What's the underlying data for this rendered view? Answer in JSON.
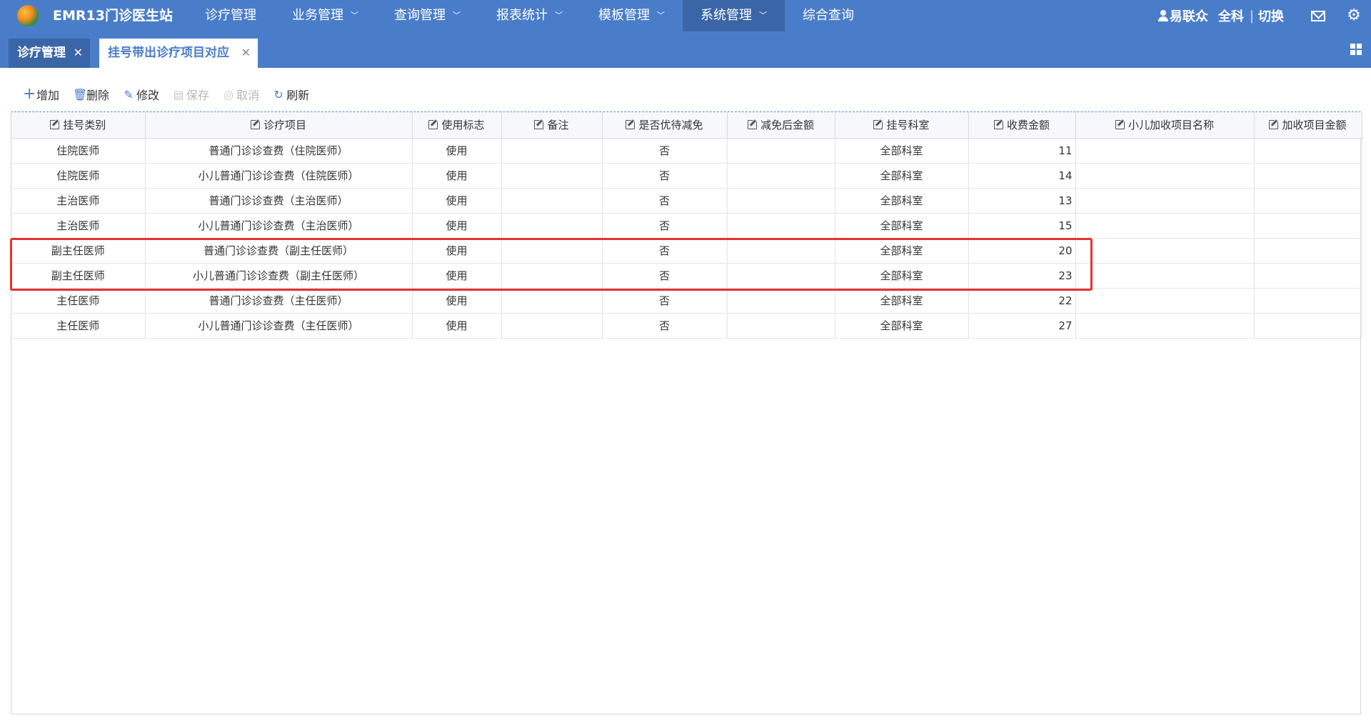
{
  "app": {
    "title": "EMR13门诊医生站"
  },
  "nav": [
    {
      "label": "诊疗管理",
      "has_dropdown": false,
      "active": false
    },
    {
      "label": "业务管理",
      "has_dropdown": true,
      "active": false
    },
    {
      "label": "查询管理",
      "has_dropdown": true,
      "active": false
    },
    {
      "label": "报表统计",
      "has_dropdown": true,
      "active": false
    },
    {
      "label": "模板管理",
      "has_dropdown": true,
      "active": false
    },
    {
      "label": "系统管理",
      "has_dropdown": true,
      "active": true
    },
    {
      "label": "综合查询",
      "has_dropdown": false,
      "active": false
    }
  ],
  "user": {
    "name": "易联众",
    "department": "全科",
    "switch_label": "切换"
  },
  "tabs": [
    {
      "label": "诊疗管理",
      "active": false
    },
    {
      "label": "挂号带出诊疗项目对应",
      "active": true
    }
  ],
  "toolbar": {
    "add": "增加",
    "delete": "删除",
    "edit": "修改",
    "save": "保存",
    "cancel": "取消",
    "refresh": "刷新"
  },
  "table": {
    "columns": [
      "挂号类别",
      "诊疗项目",
      "使用标志",
      "备注",
      "是否优待减免",
      "减免后金额",
      "挂号科室",
      "收费金额",
      "小儿加收项目名称",
      "加收项目金额"
    ],
    "rows": [
      [
        "住院医师",
        "普通门诊诊查费（住院医师）",
        "使用",
        "",
        "否",
        "",
        "全部科室",
        "11",
        "",
        ""
      ],
      [
        "住院医师",
        "小儿普通门诊诊查费（住院医师）",
        "使用",
        "",
        "否",
        "",
        "全部科室",
        "14",
        "",
        ""
      ],
      [
        "主治医师",
        "普通门诊诊查费（主治医师）",
        "使用",
        "",
        "否",
        "",
        "全部科室",
        "13",
        "",
        ""
      ],
      [
        "主治医师",
        "小儿普通门诊诊查费（主治医师）",
        "使用",
        "",
        "否",
        "",
        "全部科室",
        "15",
        "",
        ""
      ],
      [
        "副主任医师",
        "普通门诊诊查费（副主任医师）",
        "使用",
        "",
        "否",
        "",
        "全部科室",
        "20",
        "",
        ""
      ],
      [
        "副主任医师",
        "小儿普通门诊诊查费（副主任医师）",
        "使用",
        "",
        "否",
        "",
        "全部科室",
        "23",
        "",
        ""
      ],
      [
        "主任医师",
        "普通门诊诊查费（主任医师）",
        "使用",
        "",
        "否",
        "",
        "全部科室",
        "22",
        "",
        ""
      ],
      [
        "主任医师",
        "小儿普通门诊诊查费（主任医师）",
        "使用",
        "",
        "否",
        "",
        "全部科室",
        "27",
        "",
        ""
      ]
    ]
  },
  "colors": {
    "nav_bg": "#4a7dc9",
    "nav_active": "#3a66a8",
    "highlight": "#e53333"
  }
}
